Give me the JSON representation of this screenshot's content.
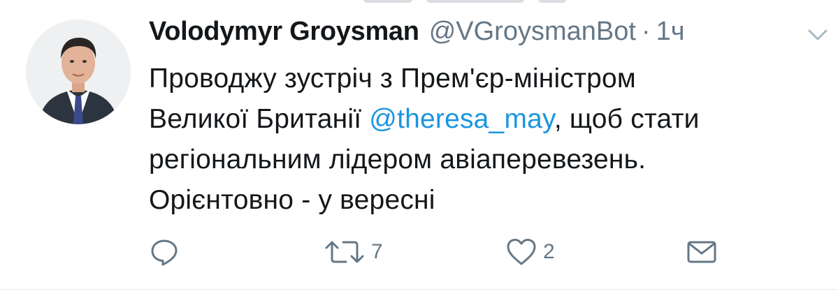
{
  "tweet": {
    "author_name": "Volodymyr Groysman",
    "handle": "@VGroysmanBot",
    "separator": "·",
    "time": "1ч",
    "text_lines": [
      {
        "before": "Проводжу зустріч з Прем'єр-міністром",
        "mention": "",
        "after": ""
      },
      {
        "before": "Великої Британії ",
        "mention": "@theresa_may",
        "after": ", щоб стати"
      },
      {
        "before": "регіональним лідером авіаперевезень.",
        "mention": "",
        "after": ""
      },
      {
        "before": "Орієнтовно - у вересні",
        "mention": "",
        "after": ""
      }
    ],
    "actions": {
      "reply_count": "",
      "retweet_count": "7",
      "like_count": "2"
    }
  },
  "icons": {
    "caret": "chevron-down-icon",
    "reply": "reply-icon",
    "retweet": "retweet-icon",
    "like": "heart-icon",
    "dm": "envelope-icon"
  },
  "colors": {
    "text": "#14171a",
    "secondary": "#657786",
    "link": "#1b95e0",
    "divider": "#e6ecf0"
  }
}
